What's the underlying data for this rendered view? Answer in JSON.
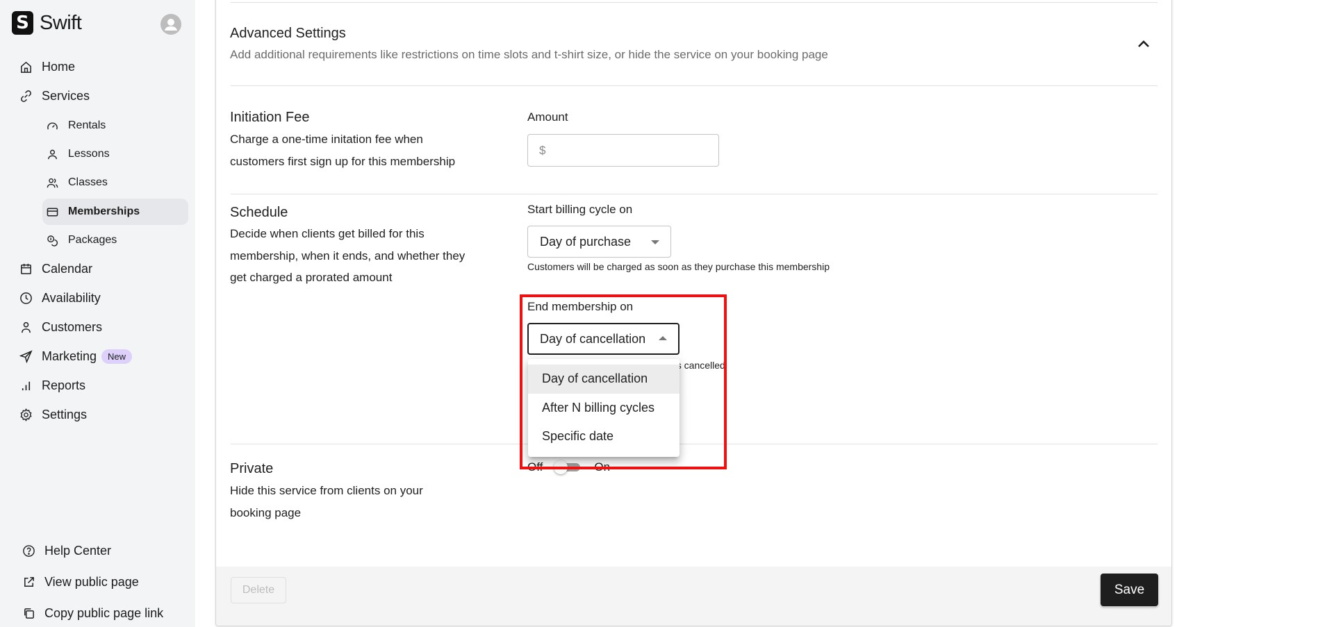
{
  "app": {
    "name": "Swift",
    "logo_letter": "S"
  },
  "sidebar": {
    "nav": [
      {
        "label": "Home",
        "icon": "home-icon"
      },
      {
        "label": "Services",
        "icon": "link-icon"
      }
    ],
    "services_sub": [
      {
        "label": "Rentals",
        "icon": "gauge-icon"
      },
      {
        "label": "Lessons",
        "icon": "person-icon"
      },
      {
        "label": "Classes",
        "icon": "people-icon"
      },
      {
        "label": "Memberships",
        "icon": "card-icon",
        "active": true
      },
      {
        "label": "Packages",
        "icon": "coins-icon"
      }
    ],
    "nav_more": [
      {
        "label": "Calendar",
        "icon": "calendar-icon"
      },
      {
        "label": "Availability",
        "icon": "clock-icon"
      },
      {
        "label": "Customers",
        "icon": "person-icon"
      },
      {
        "label": "Marketing",
        "icon": "send-icon",
        "badge": "New"
      },
      {
        "label": "Reports",
        "icon": "bar-chart-icon"
      },
      {
        "label": "Settings",
        "icon": "gear-icon"
      }
    ],
    "bottom": [
      {
        "label": "Help Center",
        "icon": "help-circle-icon"
      },
      {
        "label": "View public page",
        "icon": "external-link-icon"
      },
      {
        "label": "Copy public page link",
        "icon": "copy-icon"
      }
    ]
  },
  "advanced": {
    "title": "Advanced Settings",
    "description": "Add additional requirements like restrictions on time slots and t-shirt size, or hide the service on your booking page",
    "expanded": true
  },
  "initiation_fee": {
    "title": "Initiation Fee",
    "description": "Charge a one-time initation fee when customers first sign up for this membership",
    "amount_label": "Amount",
    "currency_prefix": "$",
    "amount_value": ""
  },
  "schedule": {
    "title": "Schedule",
    "description": "Decide when clients get billed for this membership, when it ends, and whether they get charged a prorated amount",
    "start_label": "Start billing cycle on",
    "start_value": "Day of purchase",
    "start_helper": "Customers will be charged as soon as they purchase this membership",
    "end_label": "End membership on",
    "end_value": "Day of cancellation",
    "end_helper": "Membership will end on the day it is cancelled",
    "end_options": [
      "Day of cancellation",
      "After N billing cycles",
      "Specific date"
    ],
    "end_selected_index": 0
  },
  "private": {
    "title": "Private",
    "description": "Hide this service from clients on your booking page",
    "off_label": "Off",
    "on_label": "On",
    "enabled": false
  },
  "footer": {
    "delete_label": "Delete",
    "save_label": "Save"
  },
  "colors": {
    "highlight": "#f01010",
    "badge_bg": "#ddd0fb",
    "save_bg": "#1e1e1e",
    "sidebar_bg": "#f3f4f6"
  }
}
